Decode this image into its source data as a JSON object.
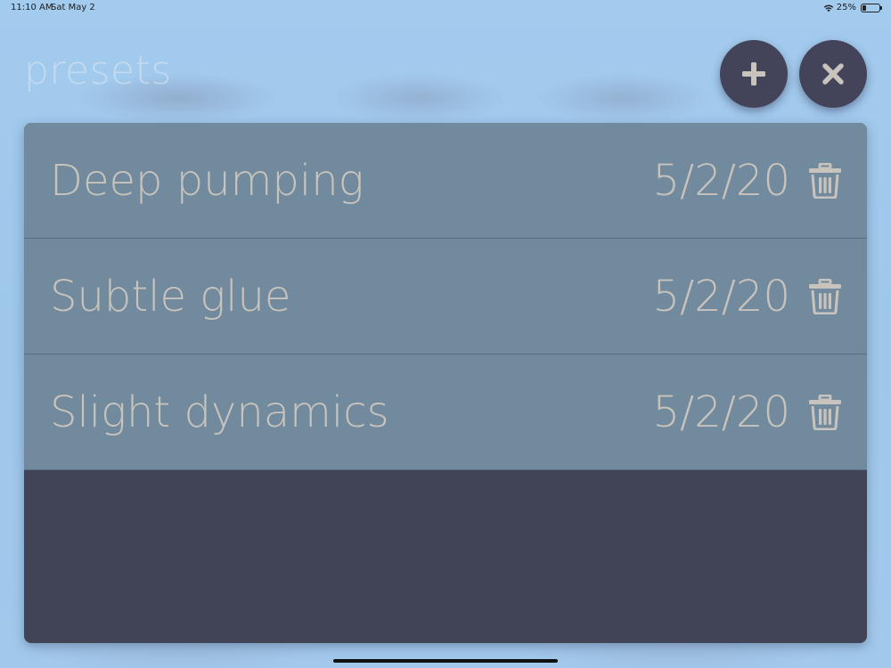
{
  "status_bar": {
    "time": "11:10 AM",
    "date": "Sat May 2",
    "battery": "25%"
  },
  "page": {
    "title": "presets"
  },
  "actions": {
    "add_icon": "plus-icon",
    "close_icon": "close-icon"
  },
  "presets": [
    {
      "name": "Deep pumping",
      "date": "5/2/20",
      "icon": "trash-icon"
    },
    {
      "name": "Subtle glue",
      "date": "5/2/20",
      "icon": "trash-icon"
    },
    {
      "name": "Slight dynamics",
      "date": "5/2/20",
      "icon": "trash-icon"
    }
  ],
  "colors": {
    "background": "#9ec7ea",
    "panel": "#414356",
    "row": "#718a9d",
    "row_text": "#c8c3bc",
    "button": "#43445a",
    "button_icon": "#c9c3bd"
  }
}
